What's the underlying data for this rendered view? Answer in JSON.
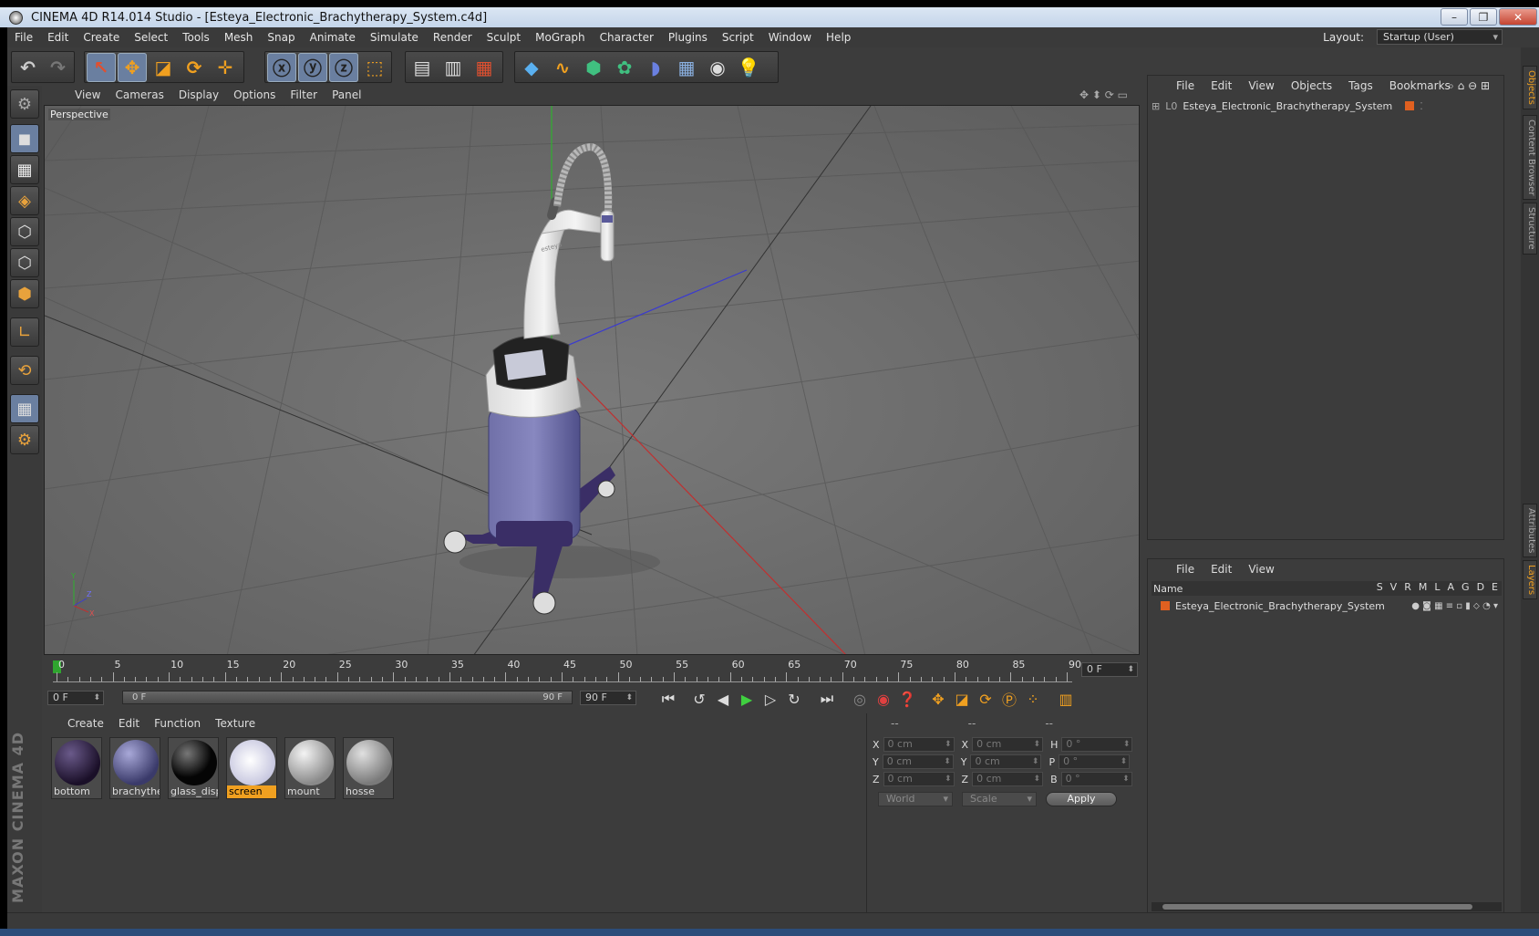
{
  "window": {
    "title": "CINEMA 4D R14.014 Studio - [Esteya_Electronic_Brachytherapy_System.c4d]",
    "controls": [
      "–",
      "❐",
      "✕"
    ]
  },
  "menubar": {
    "items": [
      "File",
      "Edit",
      "Create",
      "Select",
      "Tools",
      "Mesh",
      "Snap",
      "Animate",
      "Simulate",
      "Render",
      "Sculpt",
      "MoGraph",
      "Character",
      "Plugins",
      "Script",
      "Window",
      "Help"
    ],
    "layout_label": "Layout:",
    "layout_value": "Startup (User)"
  },
  "viewport": {
    "menu": [
      "View",
      "Cameras",
      "Display",
      "Options",
      "Filter",
      "Panel"
    ],
    "label": "Perspective",
    "axis_labels": {
      "y": "Y",
      "z": "Z",
      "x": "X"
    },
    "model_text": "esteya"
  },
  "timeline": {
    "labels": [
      "0",
      "5",
      "10",
      "15",
      "20",
      "25",
      "30",
      "35",
      "40",
      "45",
      "50",
      "55",
      "60",
      "65",
      "70",
      "75",
      "80",
      "85",
      "90"
    ],
    "current_frame": "0 F",
    "start_field": "0 F",
    "slider_start": "0 F",
    "slider_end": "90 F",
    "end_field": "90 F"
  },
  "materials": {
    "menu": [
      "Create",
      "Edit",
      "Function",
      "Texture"
    ],
    "items": [
      {
        "name": "bottom",
        "color": "#2a1a3a"
      },
      {
        "name": "brachyther",
        "color": "#5a5a8a"
      },
      {
        "name": "glass_displ",
        "color": "#111111"
      },
      {
        "name": "screen",
        "color": "#e8e8f0"
      },
      {
        "name": "mount",
        "color": "#c8c8c8"
      },
      {
        "name": "hosse",
        "color": "#9a9a9a"
      }
    ],
    "selected": "screen"
  },
  "attributes": {
    "header": [
      "--",
      "--",
      "--"
    ],
    "rows": [
      {
        "a": "X",
        "av": "0 cm",
        "b": "X",
        "bv": "0 cm",
        "c": "H",
        "cv": "0 °"
      },
      {
        "a": "Y",
        "av": "0 cm",
        "b": "Y",
        "bv": "0 cm",
        "c": "P",
        "cv": "0 °"
      },
      {
        "a": "Z",
        "av": "0 cm",
        "b": "Z",
        "bv": "0 cm",
        "c": "B",
        "cv": "0 °"
      }
    ],
    "world": "World",
    "scale": "Scale",
    "apply": "Apply"
  },
  "object_manager": {
    "menu": [
      "File",
      "Edit",
      "View",
      "Objects",
      "Tags",
      "Bookmarks"
    ],
    "object_name": "Esteya_Electronic_Brachytherapy_System"
  },
  "layer_manager": {
    "menu": [
      "File",
      "Edit",
      "View"
    ],
    "name_header": "Name",
    "columns": [
      "S",
      "V",
      "R",
      "M",
      "L",
      "A",
      "G",
      "D",
      "E"
    ],
    "layer_name": "Esteya_Electronic_Brachytherapy_System"
  },
  "side_tabs": [
    "Objects",
    "Content Browser",
    "Structure",
    "Attributes",
    "Layers"
  ],
  "branding": "MAXON CINEMA 4D",
  "colors": {
    "accent": "#f0a020",
    "highlight": "#6a7fa0",
    "background": "#3c3c3c",
    "viewport": "#6a6a6a"
  }
}
